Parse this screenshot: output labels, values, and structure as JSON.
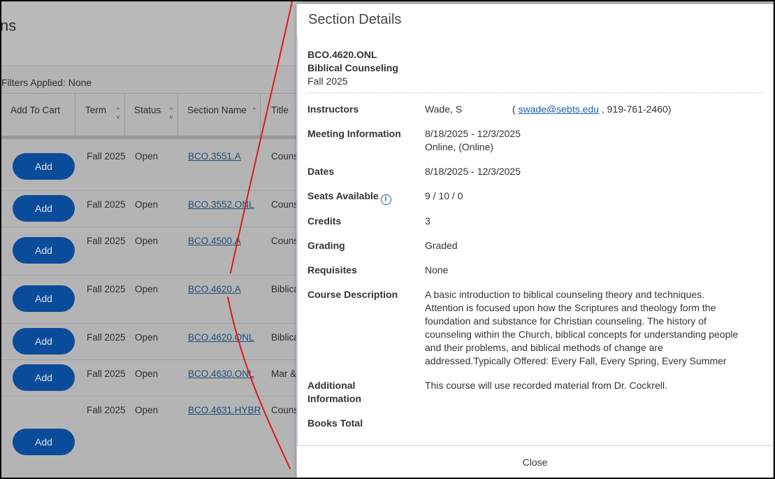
{
  "background": {
    "page_title_fragment": "ns",
    "filters_label": "Filters Applied: None",
    "columns": {
      "add_to_cart": "Add To Cart",
      "term": "Term",
      "status": "Status",
      "section_name": "Section Name",
      "title": "Title"
    },
    "rows": [
      {
        "add": "Add",
        "term": "Fall 2025",
        "status": "Open",
        "section": "BCO.3551.A",
        "title": "Couns"
      },
      {
        "add": "Add",
        "term": "Fall 2025",
        "status": "Open",
        "section": "BCO.3552.ONL",
        "title": "Couns"
      },
      {
        "add": "Add",
        "term": "Fall 2025",
        "status": "Open",
        "section": "BCO.4500.A",
        "title": "Couns"
      },
      {
        "add": "Add",
        "term": "Fall 2025",
        "status": "Open",
        "section": "BCO.4620.A",
        "title": "Biblica"
      },
      {
        "add": "Add",
        "term": "Fall 2025",
        "status": "Open",
        "section": "BCO.4620.ONL",
        "title": "Biblica"
      },
      {
        "add": "Add",
        "term": "Fall 2025",
        "status": "Open",
        "section": "BCO.4630.ONL",
        "title": "Mar &"
      },
      {
        "add": "Add",
        "term": "Fall 2025",
        "status": "Open",
        "section": "BCO.4631.HYBR",
        "title": "Couns"
      }
    ]
  },
  "modal": {
    "title": "Section Details",
    "course_code": "BCO.4620.ONL",
    "course_name": "Biblical Counseling",
    "term": "Fall 2025",
    "instructors_label": "Instructors",
    "instructor_name": "Wade, S",
    "instructor_open": "(",
    "instructor_email": "swade@sebts.edu",
    "instructor_phone": ", 919-761-2460)",
    "meeting_label": "Meeting Information",
    "meeting_dates": "8/18/2025 - 12/3/2025",
    "meeting_location": "Online, (Online)",
    "dates_label": "Dates",
    "dates_value": "8/18/2025 - 12/3/2025",
    "seats_label": "Seats Available",
    "seats_icon_glyph": "i",
    "seats_value": "9 / 10 / 0",
    "credits_label": "Credits",
    "credits_value": "3",
    "grading_label": "Grading",
    "grading_value": "Graded",
    "requisites_label": "Requisites",
    "requisites_value": "None",
    "description_label": "Course Description",
    "description_lines": [
      "A basic introduction to biblical counseling theory and techniques.",
      "Attention is focused upon how the Scriptures and theology form the",
      "foundation and substance for Christian counseling. The history of",
      "counseling within the Church, biblical concepts for understanding people",
      "and their problems, and biblical methods of change are",
      "addressed.Typically Offered: Every Fall, Every Spring, Every Summer"
    ],
    "additional_label_line1": "Additional",
    "additional_label_line2": "Information",
    "additional_value": "This course will use recorded material from Dr. Cockrell.",
    "books_label": "Books Total",
    "close_label": "Close"
  },
  "colors": {
    "add_button": "#0b4c9a",
    "link": "#1a5fb4",
    "annotation_line": "#e01818",
    "overlay": "#b4b4b4"
  }
}
